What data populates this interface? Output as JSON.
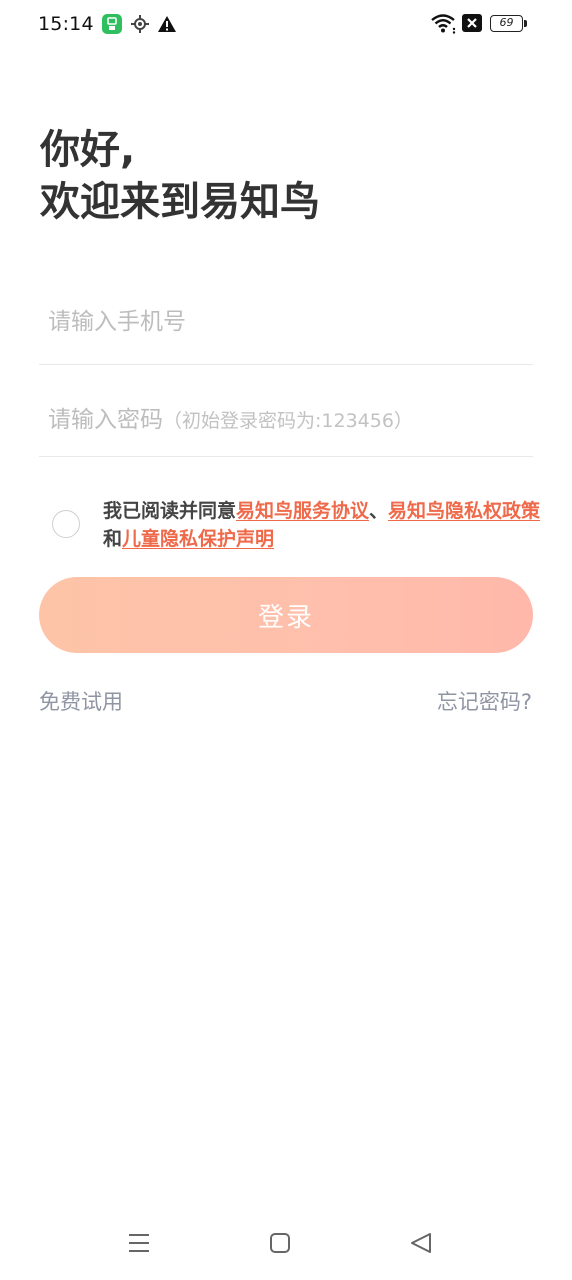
{
  "status_bar": {
    "time": "15:14",
    "battery": "69",
    "icons": [
      "app-notification-icon",
      "location-icon",
      "warning-icon",
      "wifi-icon",
      "sim-blocked-icon",
      "battery-icon"
    ]
  },
  "greeting": {
    "line1": "你好,",
    "line2": "欢迎来到易知鸟"
  },
  "form": {
    "phone_placeholder": "请输入手机号",
    "password_placeholder": "请输入密码",
    "password_hint": "（初始登录密码为:123456）"
  },
  "agreement": {
    "prefix": "我已阅读并同意",
    "service_agreement": "易知鸟服务协议",
    "separator": "、",
    "privacy_policy": "易知鸟隐私权政策",
    "conjunction": "和",
    "children_privacy": "儿童隐私保护声明",
    "checked": false
  },
  "actions": {
    "login": "登录",
    "free_trial": "免费试用",
    "forgot_password": "忘记密码?"
  },
  "colors": {
    "accent": "#ef6a4a",
    "login_gradient_start": "#fdc4a8",
    "login_gradient_end": "#ffb8aa",
    "secondary_text": "#8f95a3",
    "placeholder": "#bdbdbd"
  },
  "nav_bar": {
    "icons": [
      "menu-icon",
      "home-icon",
      "back-icon"
    ]
  }
}
